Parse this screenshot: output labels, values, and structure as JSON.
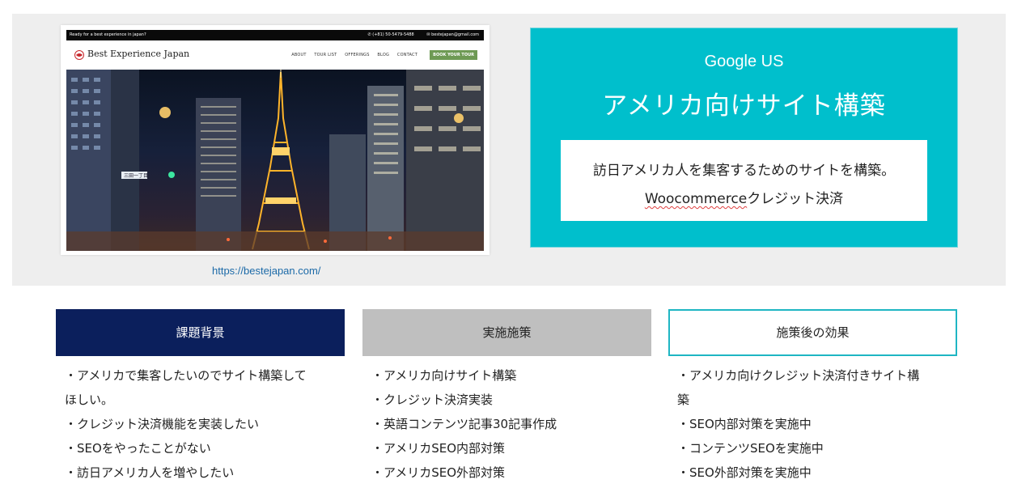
{
  "preview": {
    "topbar_left": "Ready for a best experience in japan?",
    "phone": "✆ (+81) 50-5479-5488",
    "email": "✉ bestejapan@gmail.com",
    "logo_text": "Best Experience Japan",
    "menu": [
      "ABOUT",
      "TOUR LIST",
      "OFFERINGS",
      "BLOG",
      "CONTACT"
    ],
    "cta": "BOOK YOUR TOUR",
    "street_sign": "三田一丁目"
  },
  "url": "https://bestejapan.com/",
  "card": {
    "subtitle": "Google US",
    "title": "アメリカ向けサイト構築",
    "line1": "訪日アメリカ人を集客するためのサイトを構築。",
    "line2_prefix": "Woocommerce",
    "line2_suffix": "クレジット決済"
  },
  "columns": [
    {
      "heading": "課題背景",
      "items": [
        "・アメリカで集客したいのでサイト構築して",
        "ほしい。",
        "・クレジット決済機能を実装したい",
        "・SEOをやったことがない",
        "・訪日アメリカ人を増やしたい"
      ]
    },
    {
      "heading": "実施施策",
      "items": [
        "・アメリカ向けサイト構築",
        "・クレジット決済実装",
        "・英語コンテンツ記事30記事作成",
        "・アメリカSEO内部対策",
        "・アメリカSEO外部対策"
      ]
    },
    {
      "heading": "施策後の効果",
      "items": [
        "・アメリカ向けクレジット決済付きサイト構",
        "築",
        "・SEO内部対策を実施中",
        "・コンテンツSEOを実施中",
        "・SEO外部対策を実施中"
      ]
    }
  ],
  "colors": {
    "teal": "#00bfcc",
    "navy": "#0b1f5c",
    "gray": "#bfbfbf",
    "link": "#1c6aa8",
    "cta_green": "#6e9a54"
  }
}
